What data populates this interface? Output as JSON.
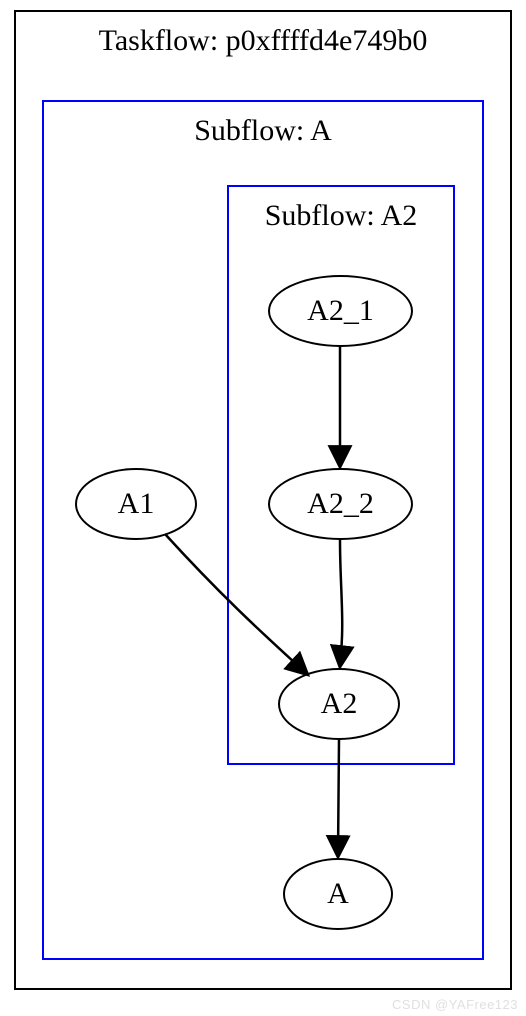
{
  "taskflow": {
    "title": "Taskflow: p0xffffd4e749b0"
  },
  "subflow_a": {
    "title": "Subflow: A"
  },
  "subflow_a2": {
    "title": "Subflow: A2"
  },
  "nodes": {
    "a2_1": "A2_1",
    "a2_2": "A2_2",
    "a1": "A1",
    "a2": "A2",
    "a": "A"
  },
  "watermark": "CSDN @YAFree123"
}
